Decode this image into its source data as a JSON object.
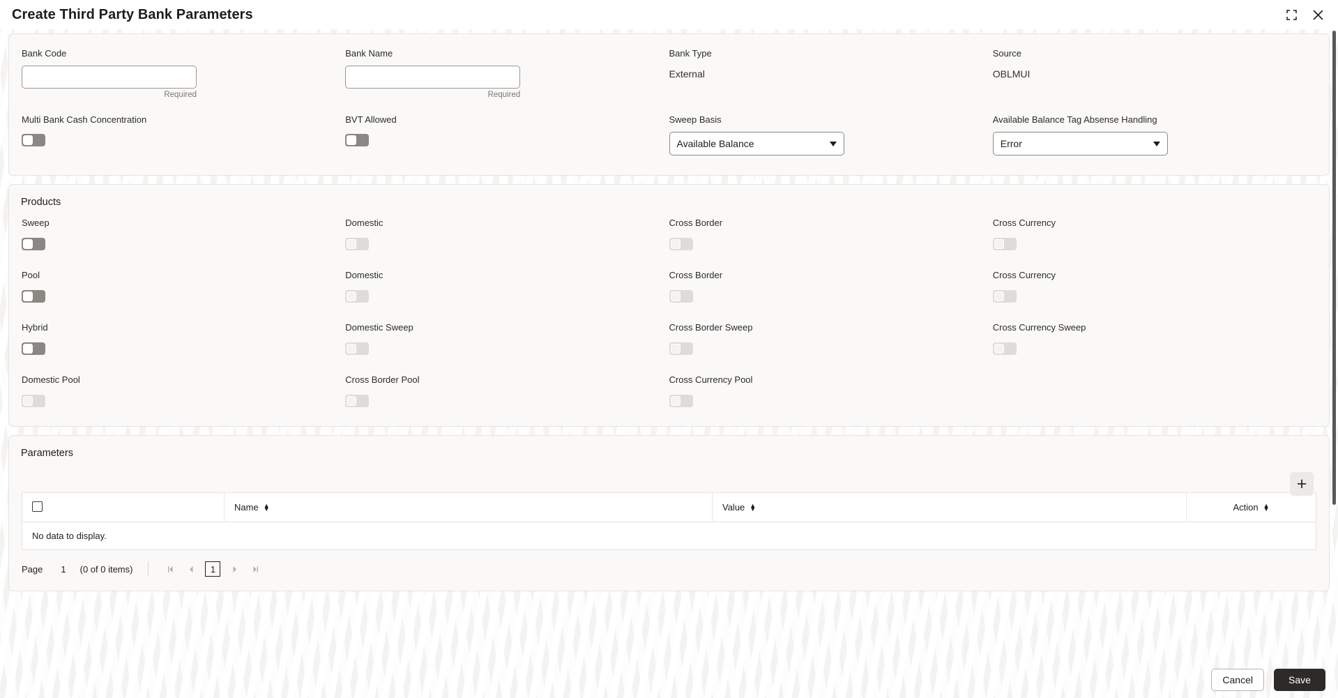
{
  "window": {
    "title": "Create Third Party Bank Parameters",
    "minimize_icon": "collapse-corners-icon",
    "close_icon": "close-icon"
  },
  "details": {
    "fields": [
      {
        "label": "Bank Code",
        "type": "input",
        "value": "",
        "helper": "Required"
      },
      {
        "label": "Bank Name",
        "type": "input",
        "value": "",
        "helper": "Required"
      },
      {
        "label": "Bank Type",
        "type": "static",
        "value": "External"
      },
      {
        "label": "Source",
        "type": "static",
        "value": "OBLMUI"
      },
      {
        "label": "Multi Bank Cash Concentration",
        "type": "toggle",
        "state": "off",
        "enabled": true
      },
      {
        "label": "BVT Allowed",
        "type": "toggle",
        "state": "off",
        "enabled": true
      },
      {
        "label": "Sweep Basis",
        "type": "select",
        "value": "Available Balance"
      },
      {
        "label": "Available Balance Tag Absense Handling",
        "type": "select",
        "value": "Error"
      }
    ]
  },
  "products": {
    "title": "Products",
    "toggles": [
      {
        "label": "Sweep",
        "state": "off",
        "enabled": true
      },
      {
        "label": "Domestic",
        "state": "off",
        "enabled": false
      },
      {
        "label": "Cross Border",
        "state": "off",
        "enabled": false
      },
      {
        "label": "Cross Currency",
        "state": "off",
        "enabled": false
      },
      {
        "label": "Pool",
        "state": "off",
        "enabled": true
      },
      {
        "label": "Domestic",
        "state": "off",
        "enabled": false
      },
      {
        "label": "Cross Border",
        "state": "off",
        "enabled": false
      },
      {
        "label": "Cross Currency",
        "state": "off",
        "enabled": false
      },
      {
        "label": "Hybrid",
        "state": "off",
        "enabled": true
      },
      {
        "label": "Domestic Sweep",
        "state": "off",
        "enabled": false
      },
      {
        "label": "Cross Border Sweep",
        "state": "off",
        "enabled": false
      },
      {
        "label": "Cross Currency Sweep",
        "state": "off",
        "enabled": false
      },
      {
        "label": "Domestic Pool",
        "state": "off",
        "enabled": false
      },
      {
        "label": "Cross Border Pool",
        "state": "off",
        "enabled": false
      },
      {
        "label": "Cross Currency Pool",
        "state": "off",
        "enabled": false
      }
    ]
  },
  "parameters": {
    "title": "Parameters",
    "add_icon": "plus-icon",
    "columns": [
      "Name",
      "Value",
      "Action"
    ],
    "empty_message": "No data to display.",
    "rows": [],
    "pagination": {
      "page_label": "Page",
      "page_number": "1",
      "items_text": "(0 of 0 items)",
      "first_icon": "|◀",
      "prev_icon": "◀",
      "current_page": "1",
      "next_icon": "▶",
      "last_icon": "▶|"
    }
  },
  "footer": {
    "cancel_label": "Cancel",
    "save_label": "Save"
  },
  "colors": {
    "accent_dark": "#2d2b29",
    "toggle_on_track": "#8c8782",
    "toggle_disabled_track": "#dedcda",
    "page_bg": "#f4f3f1",
    "card_bg": "#faf9f8"
  }
}
